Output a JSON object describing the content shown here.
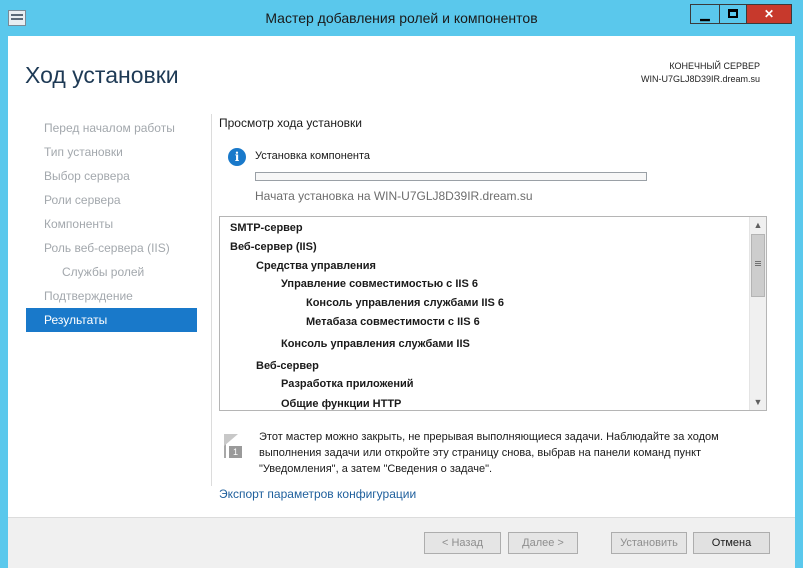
{
  "window": {
    "title": "Мастер добавления ролей и компонентов",
    "controls": {
      "minimize": "▁",
      "close": "✕"
    }
  },
  "header": {
    "title": "Ход установки",
    "destination_label": "КОНЕЧНЫЙ СЕРВЕР",
    "destination_server": "WIN-U7GLJ8D39IR.dream.su"
  },
  "sidebar": {
    "items": [
      {
        "label": "Перед началом работы",
        "state": "disabled"
      },
      {
        "label": "Тип установки",
        "state": "disabled"
      },
      {
        "label": "Выбор сервера",
        "state": "disabled"
      },
      {
        "label": "Роли сервера",
        "state": "disabled"
      },
      {
        "label": "Компоненты",
        "state": "disabled"
      },
      {
        "label": "Роль веб-сервера (IIS)",
        "state": "disabled"
      },
      {
        "label": "Службы ролей",
        "state": "disabled"
      },
      {
        "label": "Подтверждение",
        "state": "disabled"
      },
      {
        "label": "Результаты",
        "state": "active"
      }
    ]
  },
  "main": {
    "section_title": "Просмотр хода установки",
    "install_label": "Установка компонента",
    "progress": 0,
    "started_text": "Начата установка на WIN-U7GLJ8D39IR.dream.su",
    "list_items": [
      "SMTP-сервер",
      "Веб-сервер (IIS)",
      "Средства управления",
      "Управление совместимостью с IIS 6",
      "Консоль управления службами IIS 6",
      "Метабаза совместимости с IIS 6",
      "Консоль управления службами IIS",
      "Веб-сервер",
      "Разработка приложений",
      "Общие функции HTTP"
    ],
    "note_text": "Этот мастер можно закрыть, не прерывая выполняющиеся задачи. Наблюдайте за ходом выполнения задачи или откройте эту страницу снова, выбрав на панели команд пункт \"Уведомления\", а затем \"Сведения о задаче\".",
    "note_badge": "1",
    "export_link": "Экспорт параметров конфигурации"
  },
  "footer": {
    "back_label": "< Назад",
    "next_label": "Далее >",
    "install_label": "Установить",
    "cancel_label": "Отмена"
  },
  "colors": {
    "accent": "#1979ca",
    "titlebar": "#5ac8ec",
    "progress_fill": "#06b025",
    "close_button": "#c7392c"
  }
}
